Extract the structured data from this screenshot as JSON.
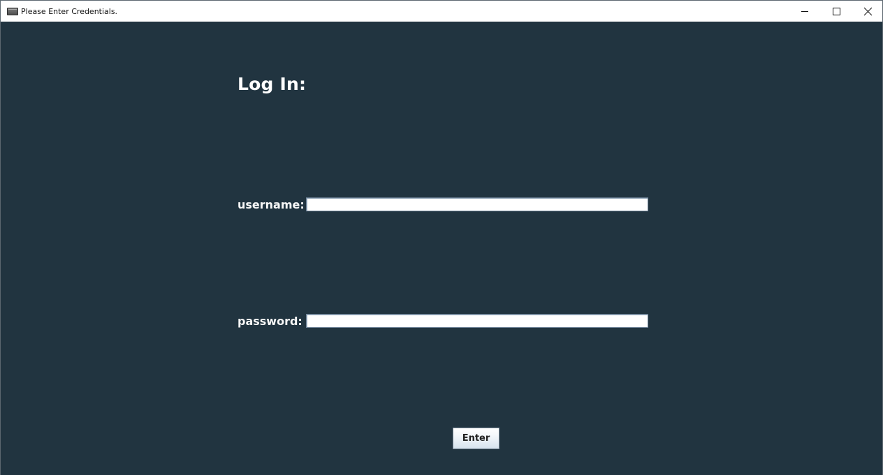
{
  "window": {
    "title": "Please Enter Credentials.",
    "background_color": "#213440",
    "titlebar_color": "#ffffff",
    "icons": {
      "app": "app-window-icon",
      "minimize": "minimize-icon",
      "maximize": "maximize-icon",
      "close": "close-icon"
    }
  },
  "login": {
    "heading": "Log In:",
    "username": {
      "label": "username:",
      "value": "",
      "placeholder": ""
    },
    "password": {
      "label": "password:",
      "value": "",
      "placeholder": ""
    },
    "enter_label": "Enter"
  }
}
